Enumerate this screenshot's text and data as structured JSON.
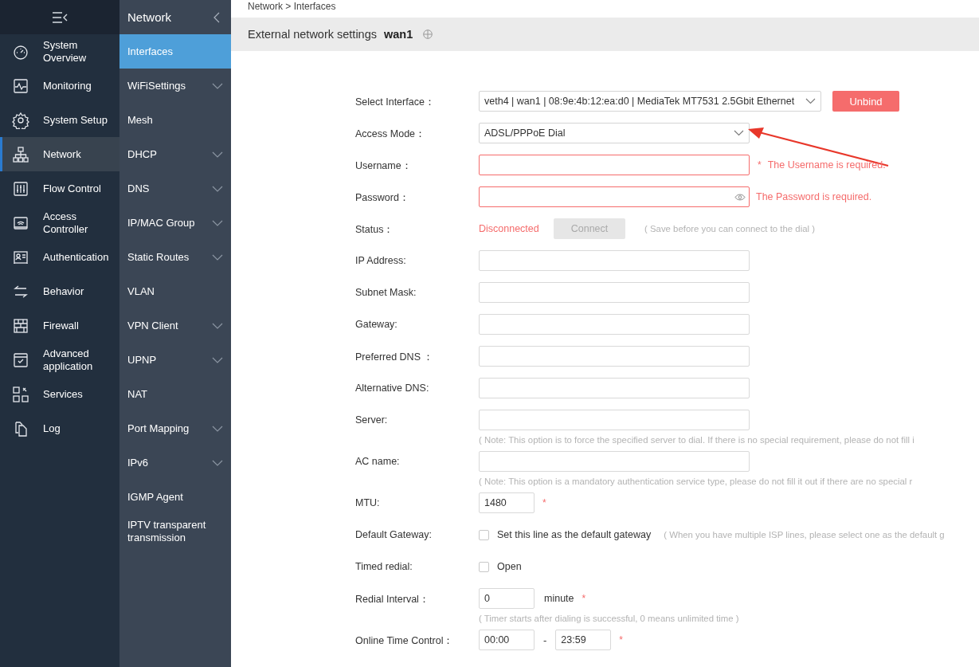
{
  "sidebar": {
    "items": [
      {
        "label": "System Overview",
        "selected": false
      },
      {
        "label": "Monitoring",
        "selected": false
      },
      {
        "label": "System Setup",
        "selected": false
      },
      {
        "label": "Network",
        "selected": true
      },
      {
        "label": "Flow Control",
        "selected": false
      },
      {
        "label": "Access Controller",
        "selected": false
      },
      {
        "label": "Authentication",
        "selected": false
      },
      {
        "label": "Behavior",
        "selected": false
      },
      {
        "label": "Firewall",
        "selected": false
      },
      {
        "label": "Advanced application",
        "selected": false
      },
      {
        "label": "Services",
        "selected": false
      },
      {
        "label": "Log",
        "selected": false
      }
    ]
  },
  "subnav": {
    "title": "Network",
    "items": [
      {
        "label": "Interfaces",
        "selected": true,
        "expandable": false
      },
      {
        "label": "WiFiSettings",
        "selected": false,
        "expandable": true
      },
      {
        "label": "Mesh",
        "selected": false,
        "expandable": false
      },
      {
        "label": "DHCP",
        "selected": false,
        "expandable": true
      },
      {
        "label": "DNS",
        "selected": false,
        "expandable": true
      },
      {
        "label": "IP/MAC Group",
        "selected": false,
        "expandable": true
      },
      {
        "label": "Static Routes",
        "selected": false,
        "expandable": true
      },
      {
        "label": "VLAN",
        "selected": false,
        "expandable": false
      },
      {
        "label": "VPN Client",
        "selected": false,
        "expandable": true
      },
      {
        "label": "UPNP",
        "selected": false,
        "expandable": true
      },
      {
        "label": "NAT",
        "selected": false,
        "expandable": false
      },
      {
        "label": "Port Mapping",
        "selected": false,
        "expandable": true
      },
      {
        "label": "IPv6",
        "selected": false,
        "expandable": true
      },
      {
        "label": "IGMP Agent",
        "selected": false,
        "expandable": false
      },
      {
        "label": "IPTV transparent transmission",
        "selected": false,
        "expandable": false
      }
    ]
  },
  "breadcrumb": "Network > Interfaces",
  "header": {
    "title": "External network settings",
    "name": "wan1"
  },
  "form": [
    {
      "kind": "select",
      "label": "Select Interface：",
      "value": "veth4 | wan1 | 08:9e:4b:12:ea:d0 | MediaTek MT7531 2.5Gbit Ethernet",
      "button": "Unbind"
    },
    {
      "kind": "select",
      "label": "Access Mode：",
      "value": "ADSL/PPPoE Dial",
      "annotated": true
    },
    {
      "kind": "input",
      "label": "Username：",
      "error": "The Username is required.",
      "required": "*"
    },
    {
      "kind": "password",
      "label": "Password：",
      "error": "The Password is required."
    },
    {
      "kind": "status",
      "label": "Status：",
      "value": "Disconnected",
      "button": "Connect",
      "note": "( Save before you can connect to the dial )"
    },
    {
      "kind": "input",
      "label": "IP Address:"
    },
    {
      "kind": "input",
      "label": "Subnet Mask:"
    },
    {
      "kind": "input",
      "label": "Gateway:"
    },
    {
      "kind": "input",
      "label": "Preferred DNS ："
    },
    {
      "kind": "input",
      "label": "Alternative DNS:"
    },
    {
      "kind": "input",
      "label": "Server:",
      "note": "( Note: This option is to force the specified server to dial. If there is no special requirement, please do not fill i"
    },
    {
      "kind": "input",
      "label": "AC name:",
      "note": "( Note: This option is a mandatory authentication service type, please do not fill it out if there are no special r"
    },
    {
      "kind": "small",
      "label": "MTU:",
      "value": "1480",
      "required": "*"
    },
    {
      "kind": "checkbox",
      "label": "Default Gateway:",
      "checked": false,
      "text": "Set this line as the default gateway",
      "hint": "( When you have multiple ISP lines, please select one as the default g"
    },
    {
      "kind": "checkbox",
      "label": "Timed redial:",
      "checked": false,
      "text": "Open"
    },
    {
      "kind": "small",
      "label": "Redial Interval：",
      "value": "0",
      "unit": "minute",
      "required": "*",
      "note": "( Timer starts after dialing is successful, 0 means unlimited time )"
    },
    {
      "kind": "range",
      "label": "Online Time Control：",
      "value": "00:00",
      "separator": "-",
      "value2": "23:59",
      "required": "*"
    }
  ]
}
